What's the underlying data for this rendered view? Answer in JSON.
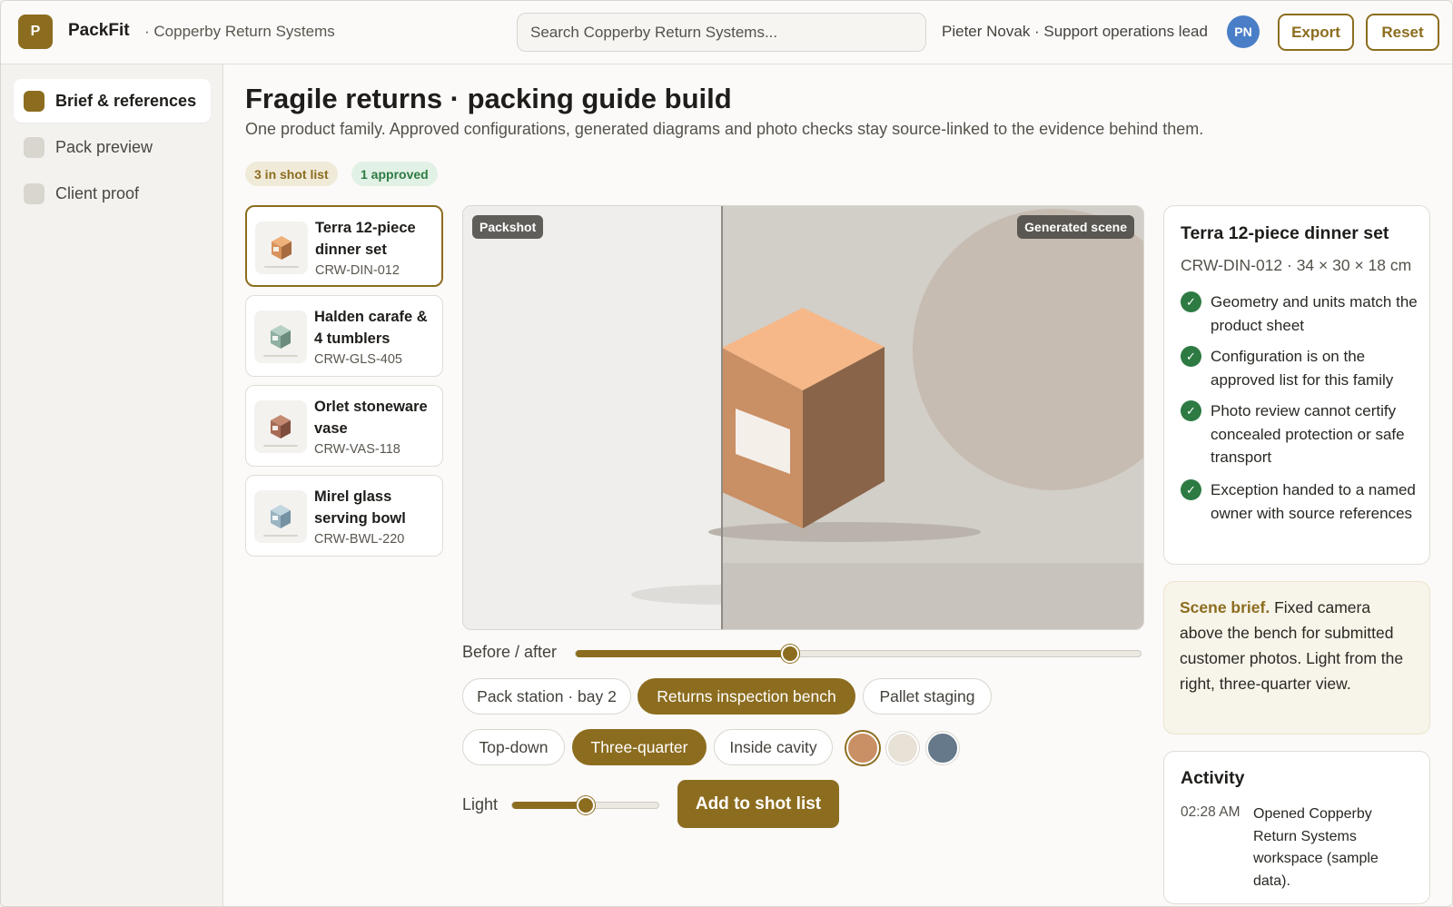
{
  "app": {
    "logo_letter": "P",
    "brand": "PackFit",
    "org": "· Copperby Return Systems",
    "accent_color": "#8c6d1f"
  },
  "header": {
    "search_placeholder": "Search Copperby Return Systems...",
    "user": "Pieter Novak · Support operations lead",
    "avatar_initials": "PN",
    "export_label": "Export",
    "reset_label": "Reset"
  },
  "sidebar": {
    "items": [
      {
        "label": "Brief & references",
        "active": true
      },
      {
        "label": "Pack preview",
        "active": false
      },
      {
        "label": "Client proof",
        "active": false
      }
    ]
  },
  "page": {
    "title": "Fragile returns · packing guide build",
    "subtitle": "One product family. Approved configurations, generated diagrams and photo checks stay source-linked to the evidence behind them.",
    "badges": {
      "shot_list": "3 in shot list",
      "approved": "1 approved"
    }
  },
  "products": [
    {
      "name": "Terra 12-piece dinner set",
      "sku": "CRW-DIN-012",
      "selected": true,
      "icon": "box-icon",
      "color": "#d9925c"
    },
    {
      "name": "Halden carafe & 4 tumblers",
      "sku": "CRW-GLS-405",
      "selected": false,
      "icon": "box-icon",
      "color": "#8fb0a2"
    },
    {
      "name": "Orlet stoneware vase",
      "sku": "CRW-VAS-118",
      "selected": false,
      "icon": "box-icon",
      "color": "#a76b55"
    },
    {
      "name": "Mirel glass serving bowl",
      "sku": "CRW-BWL-220",
      "selected": false,
      "icon": "box-icon",
      "color": "#9ab4c2"
    }
  ],
  "stage": {
    "left_tag": "Packshot",
    "right_tag": "Generated scene"
  },
  "controls": {
    "before_after_label": "Before / after",
    "before_after_value": 0.38,
    "scenes": [
      {
        "label": "Pack station · bay 2",
        "active": false
      },
      {
        "label": "Returns inspection bench",
        "active": true
      },
      {
        "label": "Pallet staging",
        "active": false
      }
    ],
    "views": [
      {
        "label": "Top-down",
        "active": false
      },
      {
        "label": "Three-quarter",
        "active": true
      },
      {
        "label": "Inside cavity",
        "active": false
      }
    ],
    "swatches": [
      {
        "color": "#c98f65",
        "active": true
      },
      {
        "color": "#e8e1d6",
        "active": false
      },
      {
        "color": "#65798a",
        "active": false
      }
    ],
    "light_label": "Light",
    "light_value": 0.5,
    "add_button": "Add to shot list"
  },
  "spec": {
    "title": "Terra 12-piece dinner set",
    "subtitle": "CRW-DIN-012 · 34 × 30 × 18 cm",
    "checks": [
      "Geometry and units match the product sheet",
      "Configuration is on the approved list for this family",
      "Photo review cannot certify concealed protection or safe transport",
      "Exception handed to a named owner with source references"
    ],
    "check_color": "#2d7a43"
  },
  "brief": {
    "heading": "Scene brief.",
    "text": "Fixed camera above the bench for submitted customer photos. Light from the right, three-quarter view."
  },
  "activity": {
    "title": "Activity",
    "entries": [
      {
        "time": "02:28 AM",
        "text": "Opened Copperby Return Systems workspace (sample data)."
      }
    ]
  }
}
